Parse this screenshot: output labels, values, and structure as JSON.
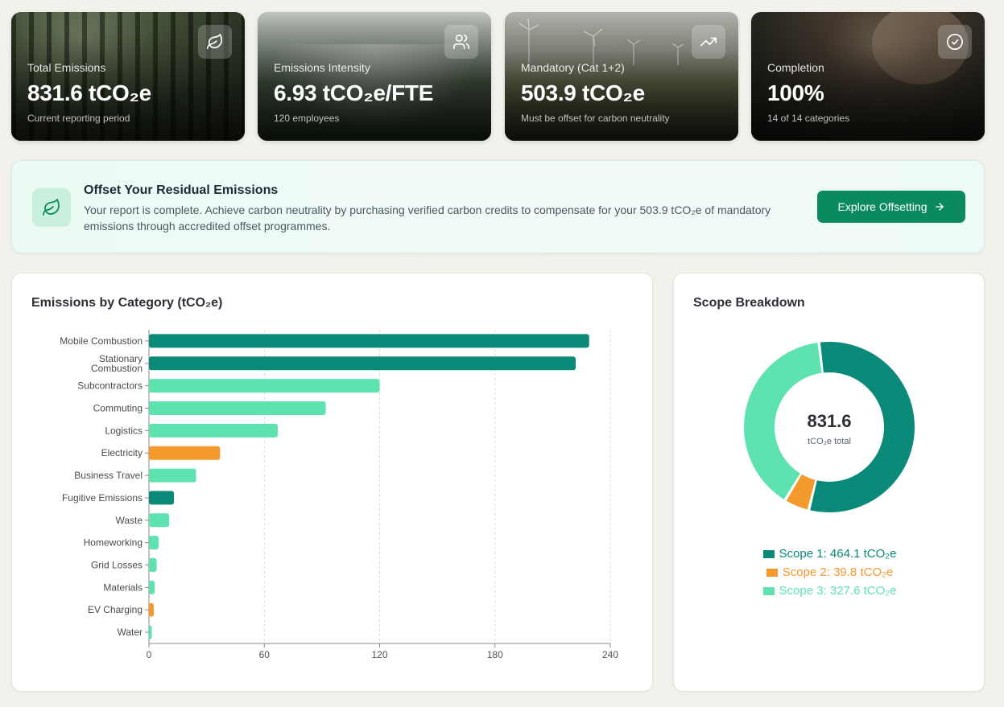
{
  "kpis": [
    {
      "label": "Total Emissions",
      "value": "831.6 tCO₂e",
      "sub": "Current reporting period",
      "icon": "leaf-icon",
      "bg": "forest"
    },
    {
      "label": "Emissions Intensity",
      "value": "6.93 tCO₂e/FTE",
      "sub": "120 employees",
      "icon": "users-icon",
      "bg": "valley"
    },
    {
      "label": "Mandatory (Cat 1+2)",
      "value": "503.9 tCO₂e",
      "sub": "Must be offset for carbon neutrality",
      "icon": "trending-up-icon",
      "bg": "wind"
    },
    {
      "label": "Completion",
      "value": "100%",
      "sub": "14 of 14 categories",
      "icon": "check-circle-icon",
      "bg": "soil"
    }
  ],
  "banner": {
    "title": "Offset Your Residual Emissions",
    "description": "Your report is complete. Achieve carbon neutrality by purchasing verified carbon credits to compensate for your 503.9 tCO₂e of mandatory emissions through accredited offset programmes.",
    "button_label": "Explore Offsetting",
    "icon": "leaf-icon"
  },
  "colors": {
    "scope1": "#0b8a7a",
    "scope2": "#f49a2c",
    "scope3": "#5ee2b0",
    "accent": "#0b8b5d"
  },
  "category_panel": {
    "title": "Emissions by Category (tCO₂e)"
  },
  "scope_panel": {
    "title": "Scope Breakdown",
    "center_value": "831.6",
    "center_label": "tCO₂e total",
    "legend": [
      {
        "label": "Scope 1: 464.1 tCO₂e",
        "scope": "scope1"
      },
      {
        "label": "Scope 2: 39.8 tCO₂e",
        "scope": "scope2"
      },
      {
        "label": "Scope 3: 327.6 tCO₂e",
        "scope": "scope3"
      }
    ]
  },
  "chart_data": [
    {
      "type": "bar",
      "orientation": "horizontal",
      "title": "Emissions by Category (tCO₂e)",
      "categories": [
        "Mobile Combustion",
        "Stationary Combustion",
        "Subcontractors",
        "Commuting",
        "Logistics",
        "Electricity",
        "Business Travel",
        "Fugitive Emissions",
        "Waste",
        "Homeworking",
        "Grid Losses",
        "Materials",
        "EV Charging",
        "Water"
      ],
      "values": [
        229,
        222,
        120,
        92,
        67,
        37,
        24.5,
        13,
        10.5,
        5,
        4,
        3,
        2.5,
        1.5
      ],
      "scopes": [
        "scope1",
        "scope1",
        "scope3",
        "scope3",
        "scope3",
        "scope2",
        "scope3",
        "scope1",
        "scope3",
        "scope3",
        "scope3",
        "scope3",
        "scope2",
        "scope3"
      ],
      "xlim": [
        0,
        240
      ],
      "xticks": [
        0,
        60,
        120,
        180,
        240
      ],
      "grid": "vertical dashed"
    },
    {
      "type": "pie",
      "title": "Scope Breakdown",
      "categories": [
        "Scope 1",
        "Scope 2",
        "Scope 3"
      ],
      "values": [
        464.1,
        39.8,
        327.6
      ],
      "total": 831.6,
      "unit": "tCO₂e",
      "legend": "bottom"
    }
  ]
}
